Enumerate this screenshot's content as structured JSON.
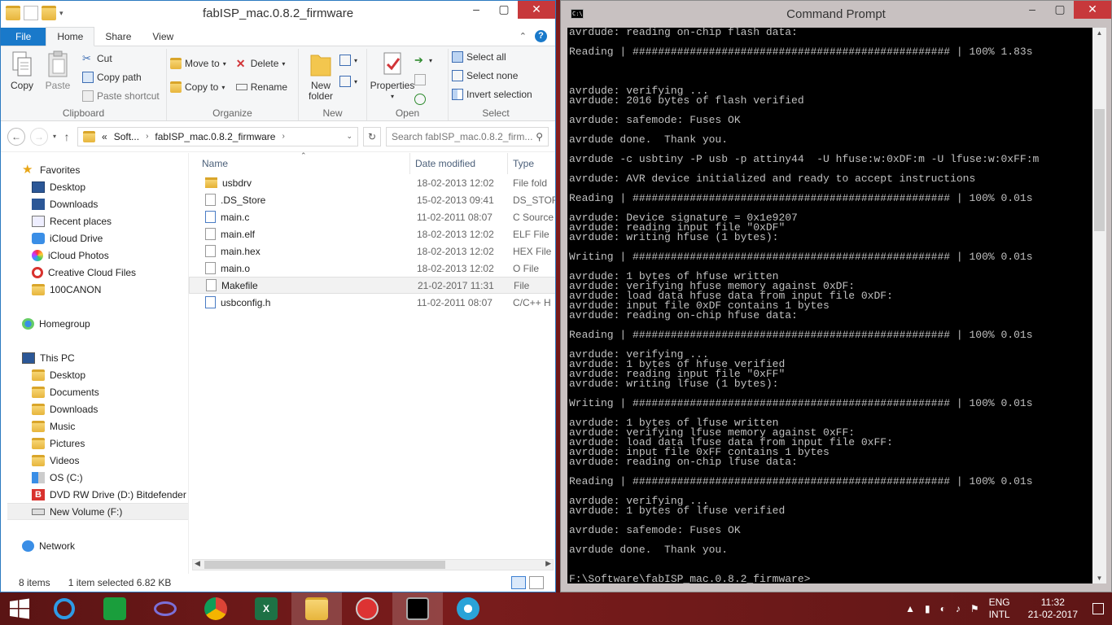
{
  "explorer": {
    "title": "fabISP_mac.0.8.2_firmware",
    "tabs": [
      "File",
      "Home",
      "Share",
      "View"
    ],
    "ribbon": {
      "clipboard": {
        "label": "Clipboard",
        "copy": "Copy",
        "paste": "Paste",
        "cut": "Cut",
        "copy_path": "Copy path",
        "paste_shortcut": "Paste shortcut"
      },
      "organize": {
        "label": "Organize",
        "move_to": "Move to",
        "copy_to": "Copy to",
        "delete": "Delete",
        "rename": "Rename"
      },
      "new": {
        "label": "New",
        "new_folder_line1": "New",
        "new_folder_line2": "folder"
      },
      "open": {
        "label": "Open",
        "properties": "Properties"
      },
      "select": {
        "label": "Select",
        "select_all": "Select all",
        "select_none": "Select none",
        "invert": "Invert selection"
      }
    },
    "address": {
      "prefix": "«",
      "crumb1": "Soft...",
      "crumb2": "fabISP_mac.0.8.2_firmware",
      "search_placeholder": "Search fabISP_mac.0.8.2_firm..."
    },
    "nav": {
      "favorites": "Favorites",
      "favorite_items": [
        "Desktop",
        "Downloads",
        "Recent places",
        "iCloud Drive",
        "iCloud Photos",
        "Creative Cloud Files",
        "100CANON"
      ],
      "homegroup": "Homegroup",
      "this_pc": "This PC",
      "pc_items": [
        "Desktop",
        "Documents",
        "Downloads",
        "Music",
        "Pictures",
        "Videos",
        "OS (C:)",
        "DVD RW Drive (D:) Bitdefender",
        "New Volume (F:)"
      ],
      "network": "Network"
    },
    "columns": {
      "name": "Name",
      "date": "Date modified",
      "type": "Type"
    },
    "files": [
      {
        "name": "usbdrv",
        "date": "18-02-2013 12:02",
        "type": "File fold"
      },
      {
        "name": ".DS_Store",
        "date": "15-02-2013 09:41",
        "type": "DS_STOR"
      },
      {
        "name": "main.c",
        "date": "11-02-2011 08:07",
        "type": "C Source"
      },
      {
        "name": "main.elf",
        "date": "18-02-2013 12:02",
        "type": "ELF File"
      },
      {
        "name": "main.hex",
        "date": "18-02-2013 12:02",
        "type": "HEX File"
      },
      {
        "name": "main.o",
        "date": "18-02-2013 12:02",
        "type": "O File"
      },
      {
        "name": "Makefile",
        "date": "21-02-2017 11:31",
        "type": "File"
      },
      {
        "name": "usbconfig.h",
        "date": "11-02-2011 08:07",
        "type": "C/C++ H"
      }
    ],
    "status": {
      "count": "8 items",
      "selection": "1 item selected  6.82 KB"
    }
  },
  "cmd": {
    "title": "Command Prompt",
    "output": "avrdude: reading on-chip flash data:\n\nReading | ################################################## | 100% 1.83s\n\n\n\navrdude: verifying ...\navrdude: 2016 bytes of flash verified\n\navrdude: safemode: Fuses OK\n\navrdude done.  Thank you.\n\navrdude -c usbtiny -P usb -p attiny44  -U hfuse:w:0xDF:m -U lfuse:w:0xFF:m\n\navrdude: AVR device initialized and ready to accept instructions\n\nReading | ################################################## | 100% 0.01s\n\navrdude: Device signature = 0x1e9207\navrdude: reading input file \"0xDF\"\navrdude: writing hfuse (1 bytes):\n\nWriting | ################################################## | 100% 0.01s\n\navrdude: 1 bytes of hfuse written\navrdude: verifying hfuse memory against 0xDF:\navrdude: load data hfuse data from input file 0xDF:\navrdude: input file 0xDF contains 1 bytes\navrdude: reading on-chip hfuse data:\n\nReading | ################################################## | 100% 0.01s\n\navrdude: verifying ...\navrdude: 1 bytes of hfuse verified\navrdude: reading input file \"0xFF\"\navrdude: writing lfuse (1 bytes):\n\nWriting | ################################################## | 100% 0.01s\n\navrdude: 1 bytes of lfuse written\navrdude: verifying lfuse memory against 0xFF:\navrdude: load data lfuse data from input file 0xFF:\navrdude: input file 0xFF contains 1 bytes\navrdude: reading on-chip lfuse data:\n\nReading | ################################################## | 100% 0.01s\n\navrdude: verifying ...\navrdude: 1 bytes of lfuse verified\n\navrdude: safemode: Fuses OK\n\navrdude done.  Thank you.\n\n\nF:\\Software\\fabISP_mac.0.8.2_firmware>"
  },
  "taskbar": {
    "lang": "ENG",
    "layout": "INTL",
    "time": "11:32",
    "date": "21-02-2017"
  }
}
